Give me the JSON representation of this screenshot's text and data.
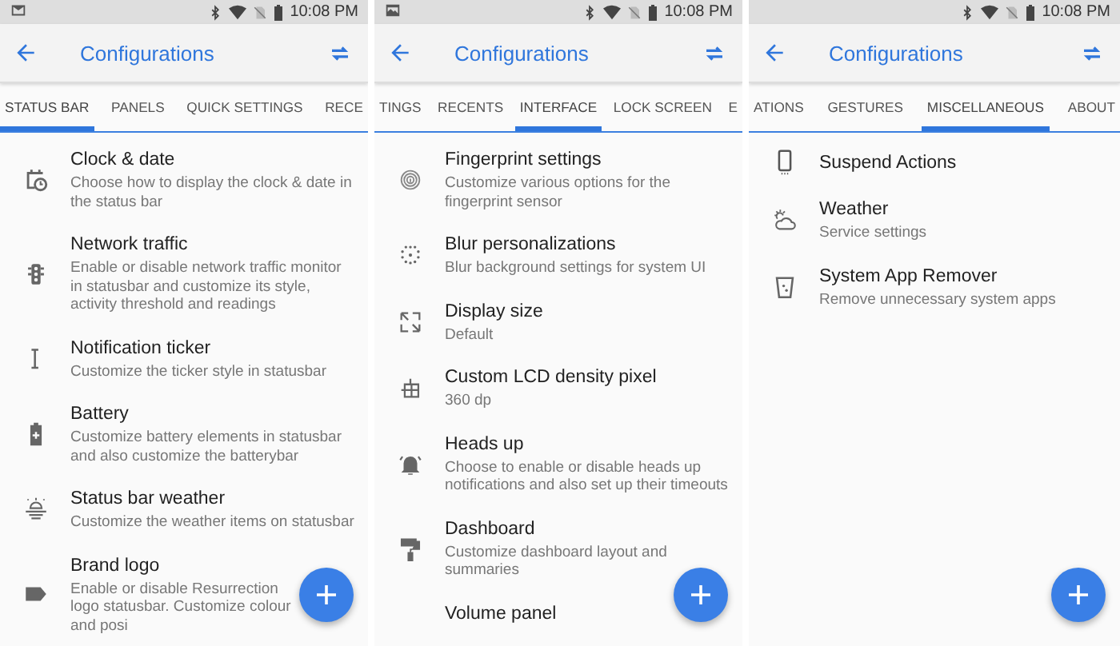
{
  "screens": [
    {
      "status_bar": {
        "time": "10:08 PM"
      },
      "toolbar": {
        "title": "Configurations"
      },
      "tabs": [
        {
          "label": "STATUS BAR",
          "selected": true
        },
        {
          "label": "PANELS",
          "selected": false
        },
        {
          "label": "QUICK SETTINGS",
          "selected": false
        },
        {
          "label": "RECE",
          "selected": false
        }
      ],
      "items": [
        {
          "title": "Clock & date",
          "description": "Choose how to display the clock & date in the status bar"
        },
        {
          "title": "Network traffic",
          "description": "Enable or disable network traffic monitor in statusbar and customize its style, activity threshold and readings"
        },
        {
          "title": "Notification ticker",
          "description": "Customize the ticker style in statusbar"
        },
        {
          "title": "Battery",
          "description": "Customize battery elements in statusbar and also customize the batterybar"
        },
        {
          "title": "Status bar weather",
          "description": "Customize the weather items on statusbar"
        },
        {
          "title": "Brand logo",
          "description": "Enable or disable Resurrection logo statusbar. Customize colour and posi"
        }
      ]
    },
    {
      "status_bar": {
        "time": "10:08 PM"
      },
      "toolbar": {
        "title": "Configurations"
      },
      "tabs": [
        {
          "label": "TINGS",
          "selected": false
        },
        {
          "label": "RECENTS",
          "selected": false
        },
        {
          "label": "INTERFACE",
          "selected": true
        },
        {
          "label": "LOCK SCREEN",
          "selected": false
        },
        {
          "label": "E",
          "selected": false
        }
      ],
      "items": [
        {
          "title": "Fingerprint settings",
          "description": "Customize various options for the fingerprint sensor"
        },
        {
          "title": "Blur personalizations",
          "description": "Blur background settings for system UI"
        },
        {
          "title": "Display size",
          "description": "Default"
        },
        {
          "title": "Custom LCD density pixel",
          "description": "360 dp"
        },
        {
          "title": "Heads up",
          "description": "Choose to enable or disable heads up notifications and also set up their timeouts"
        },
        {
          "title": "Dashboard",
          "description": "Customize dashboard layout and summaries"
        },
        {
          "title": "Volume panel"
        }
      ]
    },
    {
      "status_bar": {
        "time": "10:08 PM"
      },
      "toolbar": {
        "title": "Configurations"
      },
      "tabs": [
        {
          "label": "ATIONS",
          "selected": false
        },
        {
          "label": "GESTURES",
          "selected": false
        },
        {
          "label": "MISCELLANEOUS",
          "selected": true
        },
        {
          "label": "ABOUT",
          "selected": false
        }
      ],
      "items": [
        {
          "title": "Suspend Actions"
        },
        {
          "title": "Weather",
          "description": "Service settings"
        },
        {
          "title": "System App Remover",
          "description": "Remove unnecessary system apps"
        }
      ]
    }
  ]
}
